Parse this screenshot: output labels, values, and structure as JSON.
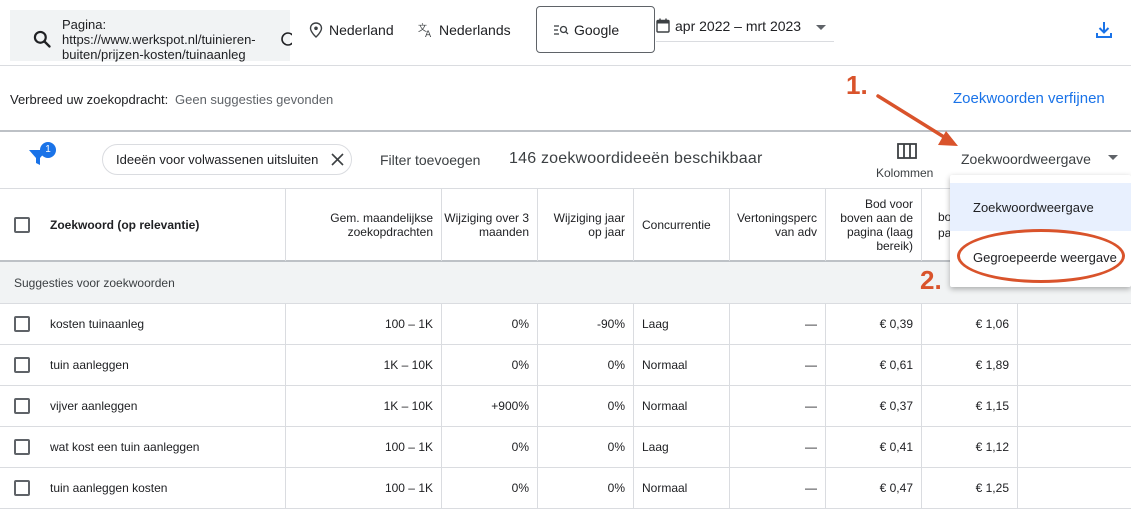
{
  "topbar": {
    "page_text": "Pagina: https://www.werkspot.nl/tuinieren-buiten/prijzen-kosten/tuinaanleg",
    "location": "Nederland",
    "language": "Nederlands",
    "network": "Google",
    "date_range": "apr 2022 – mrt 2023",
    "icons": [
      "search-icon",
      "location-pin-icon",
      "translate-icon",
      "search-list-icon",
      "calendar-icon",
      "download-icon"
    ]
  },
  "refine": {
    "label": "Verbreed uw zoekopdracht:",
    "no_suggestions": "Geen suggesties gevonden",
    "refine_link": "Zoekwoorden verfijnen"
  },
  "annotations": {
    "step1": "1.",
    "step2": "2.",
    "color": "#d9532b"
  },
  "filterbar": {
    "filter_badge": "1",
    "chip_label": "Ideeën voor volwassenen uitsluiten",
    "add_filter": "Filter toevoegen",
    "count_text": "146 zoekwoordideeën beschikbaar",
    "columns_label": "Kolommen",
    "view_select": "Zoekwoordweergave"
  },
  "dropdown": {
    "options": [
      "Zoekwoordweergave",
      "Gegroepeerde weergave"
    ],
    "selected": "Zoekwoordweergave"
  },
  "table": {
    "headers": [
      "Zoekwoord (op relevantie)",
      "Gem. maandelijkse zoekopdrachten",
      "Wijziging over 3 maanden",
      "Wijziging jaar op jaar",
      "Concurrentie",
      "Vertoningsperc van adv",
      "Bod voor boven aan de pagina (laag bereik)",
      "bo pa"
    ],
    "section_label": "Suggesties voor zoekwoorden",
    "rows": [
      {
        "keyword": "kosten tuinaanleg",
        "searches": "100 – 1K",
        "change3m": "0%",
        "yoy": "-90%",
        "competition": "Laag",
        "impression": "—",
        "bid_low": "€ 0,39",
        "bid_high": "€ 1,06"
      },
      {
        "keyword": "tuin aanleggen",
        "searches": "1K – 10K",
        "change3m": "0%",
        "yoy": "0%",
        "competition": "Normaal",
        "impression": "—",
        "bid_low": "€ 0,61",
        "bid_high": "€ 1,89"
      },
      {
        "keyword": "vijver aanleggen",
        "searches": "1K – 10K",
        "change3m": "+900%",
        "yoy": "0%",
        "competition": "Normaal",
        "impression": "—",
        "bid_low": "€ 0,37",
        "bid_high": "€ 1,15"
      },
      {
        "keyword": "wat kost een tuin aanleggen",
        "searches": "100 – 1K",
        "change3m": "0%",
        "yoy": "0%",
        "competition": "Laag",
        "impression": "—",
        "bid_low": "€ 0,41",
        "bid_high": "€ 1,12"
      },
      {
        "keyword": "tuin aanleggen kosten",
        "searches": "100 – 1K",
        "change3m": "0%",
        "yoy": "0%",
        "competition": "Normaal",
        "impression": "—",
        "bid_low": "€ 0,47",
        "bid_high": "€ 1,25"
      }
    ]
  }
}
